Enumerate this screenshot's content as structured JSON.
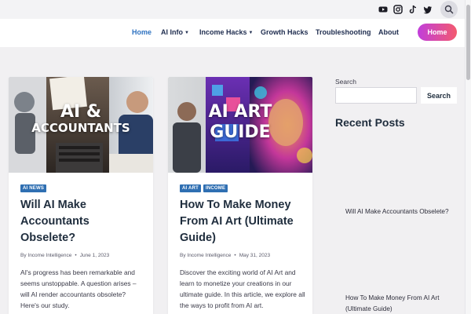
{
  "topbar": {
    "social": [
      {
        "name": "youtube-icon"
      },
      {
        "name": "instagram-icon"
      },
      {
        "name": "tiktok-icon"
      },
      {
        "name": "twitter-icon"
      }
    ],
    "search_icon": "search-icon"
  },
  "nav": {
    "home": "Home",
    "ai_info": "AI Info",
    "income_hacks": "Income Hacks",
    "growth_hacks": "Growth Hacks",
    "troubleshooting": "Troubleshooting",
    "about": "About",
    "home_button": "Home"
  },
  "colors": {
    "accent_blue": "#2e72c0",
    "tag_blue": "#2f6fb2",
    "button_gradient_start": "#c13edb",
    "button_gradient_end": "#f35a6f"
  },
  "posts": [
    {
      "image_text_1": "AI &",
      "image_text_2": "ACCOUNTANTS",
      "tags": [
        "AI NEWS"
      ],
      "title": "Will AI Make Accountants Obselete?",
      "author": "By Income Intelligence",
      "date": "June 1, 2023",
      "excerpt": "AI's progress has been remarkable and seems unstoppable. A question arises – will AI render accountants obsolete? Here's our study."
    },
    {
      "image_text_1": "AI ART",
      "image_text_2": "GUIDE",
      "tags": [
        "AI ART",
        "INCOME"
      ],
      "title": "How To Make Money From AI Art (Ultimate Guide)",
      "author": "By Income Intelligence",
      "date": "May 31, 2023",
      "excerpt": "Discover the exciting world of AI Art and learn to monetize your creations in our ultimate guide. In this article, we explore all the ways to profit from AI art."
    }
  ],
  "sidebar": {
    "search_label": "Search",
    "search_button": "Search",
    "recent_heading": "Recent Posts",
    "recent": [
      "Will AI Make Accountants Obselete?",
      "How To Make Money From AI Art (Ultimate Guide)"
    ]
  }
}
